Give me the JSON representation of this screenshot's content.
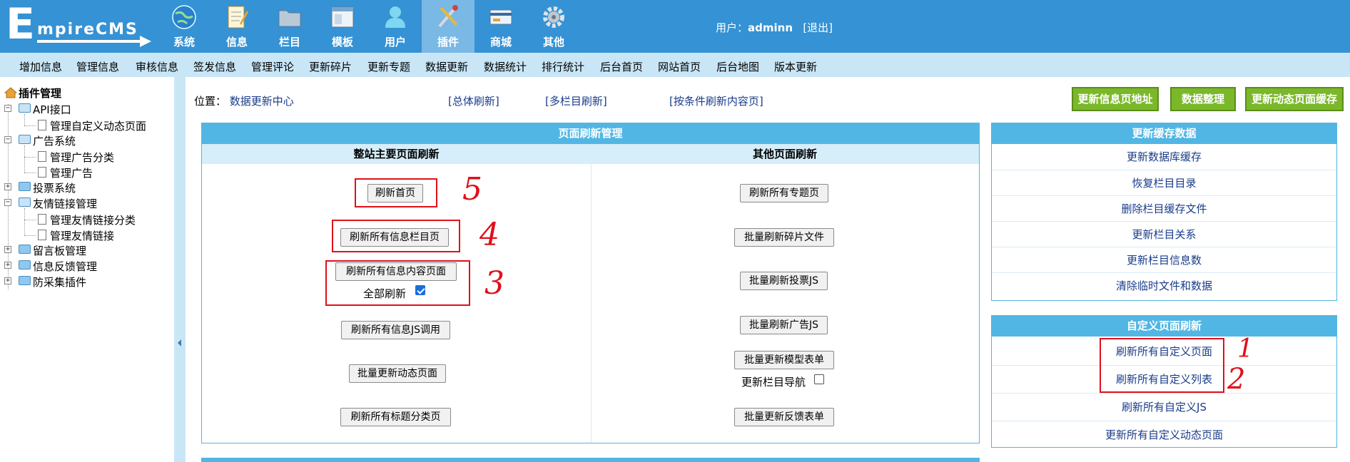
{
  "header": {
    "logo_big": "E",
    "logo_rest": "mpireCMS",
    "nav": [
      {
        "label": "系统",
        "icon": "globe-icon"
      },
      {
        "label": "信息",
        "icon": "notepad-icon"
      },
      {
        "label": "栏目",
        "icon": "folder-icon"
      },
      {
        "label": "模板",
        "icon": "window-icon"
      },
      {
        "label": "用户",
        "icon": "user-icon"
      },
      {
        "label": "插件",
        "icon": "tools-icon"
      },
      {
        "label": "商城",
        "icon": "card-icon"
      },
      {
        "label": "其他",
        "icon": "gear-icon"
      }
    ],
    "active_nav": "插件",
    "user_label": "用户：",
    "username": "adminn",
    "logout": "[退出]"
  },
  "submenu": [
    "增加信息",
    "管理信息",
    "审核信息",
    "签发信息",
    "管理评论",
    "更新碎片",
    "更新专题",
    "数据更新",
    "数据统计",
    "排行统计",
    "后台首页",
    "网站首页",
    "后台地图",
    "版本更新"
  ],
  "tree": {
    "root": "插件管理",
    "api": "API接口",
    "api_child": "管理自定义动态页面",
    "ad": "广告系统",
    "ad_child1": "管理广告分类",
    "ad_child2": "管理广告",
    "vote": "投票系统",
    "link": "友情链接管理",
    "link_child1": "管理友情链接分类",
    "link_child2": "管理友情链接",
    "guestbook": "留言板管理",
    "feedback": "信息反馈管理",
    "anticollect": "防采集插件"
  },
  "location": {
    "label": "位置：",
    "link": "数据更新中心"
  },
  "toplinks": [
    "[总体刷新]",
    "[多栏目刷新]",
    "[按条件刷新内容页]"
  ],
  "greenbuttons": [
    "更新信息页地址",
    "数据整理",
    "更新动态页面缓存"
  ],
  "refresh_panel": {
    "title": "页面刷新管理",
    "left_head": "整站主要页面刷新",
    "right_head": "其他页面刷新",
    "left_buttons": [
      "刷新首页",
      "刷新所有信息栏目页",
      "刷新所有信息内容页面",
      "刷新所有信息JS调用",
      "批量更新动态页面",
      "刷新所有标题分类页"
    ],
    "all_refresh_label": "全部刷新",
    "all_refresh_checked": true,
    "right_buttons": [
      "刷新所有专题页",
      "批量刷新碎片文件",
      "批量刷新投票JS",
      "批量刷新广告JS",
      "批量更新模型表单",
      "批量更新反馈表单"
    ],
    "update_nav_label": "更新栏目导航",
    "update_nav_checked": false
  },
  "cache_panel": {
    "title": "更新缓存数据",
    "links": [
      "更新数据库缓存",
      "恢复栏目目录",
      "删除栏目缓存文件",
      "更新栏目关系",
      "更新栏目信息数",
      "清除临时文件和数据"
    ]
  },
  "custom_panel": {
    "title": "自定义页面刷新",
    "links": [
      "刷新所有自定义页面",
      "刷新所有自定义列表",
      "刷新所有自定义JS",
      "更新所有自定义动态页面"
    ]
  },
  "annotations": [
    "5",
    "4",
    "3",
    "1",
    "2"
  ],
  "colors": {
    "header_bg": "#3592d4",
    "submenu_bg": "#c9e6f7",
    "panel_head": "#52b6e4",
    "green_button": "#7ab82a",
    "annotation_red": "#e0101a"
  }
}
